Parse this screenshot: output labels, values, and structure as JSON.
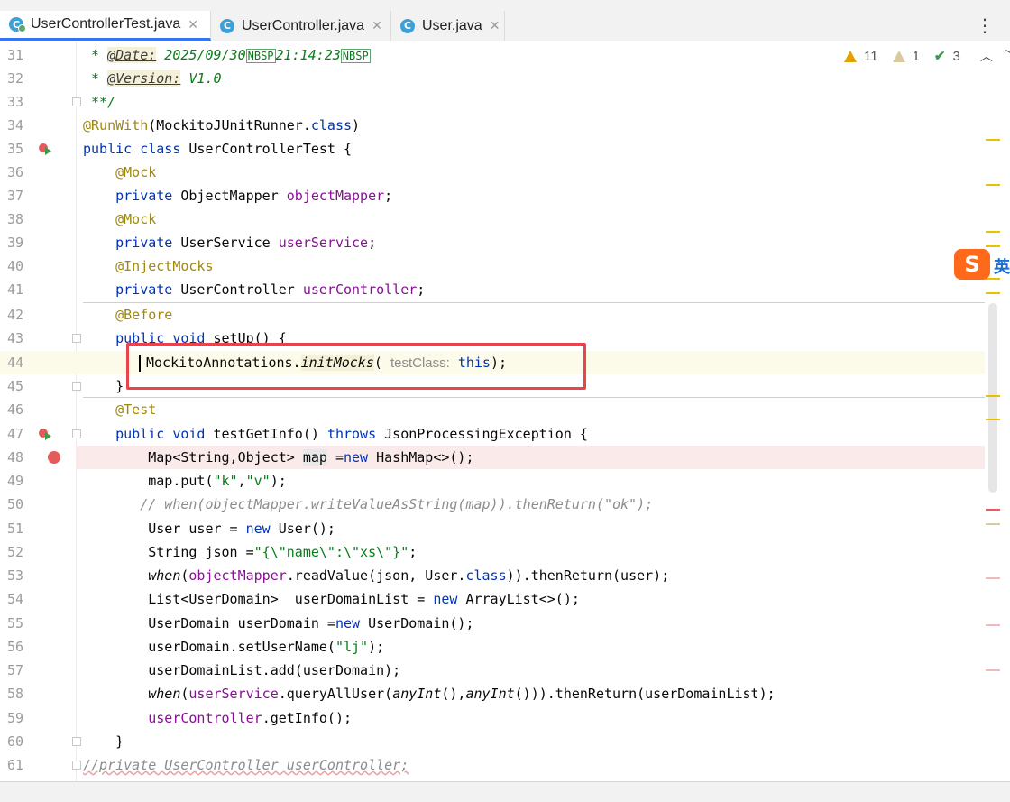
{
  "tabs": [
    {
      "label": "UserControllerTest.java",
      "active": true
    },
    {
      "label": "UserController.java",
      "active": false
    },
    {
      "label": "User.java",
      "active": false
    }
  ],
  "tab_menu_icon": "vertical-dots-icon",
  "inspections": {
    "warnings": "11",
    "weak_warnings": "1",
    "typos": "3"
  },
  "line_numbers": [
    "31",
    "32",
    "33",
    "34",
    "35",
    "36",
    "37",
    "38",
    "39",
    "40",
    "41",
    "42",
    "43",
    "44",
    "45",
    "46",
    "47",
    "48",
    "49",
    "50",
    "51",
    "52",
    "53",
    "54",
    "55",
    "56",
    "57",
    "58",
    "59",
    "60",
    "61"
  ],
  "code": {
    "l31": {
      "star": " * ",
      "tag": "@Date:",
      "val1": " 2025/09/30",
      "nb1": "NBSP",
      "val2": "21:14:23",
      "nb2": "NBSP"
    },
    "l32": {
      "star": " * ",
      "tag": "@Version:",
      "val": " V1.0"
    },
    "l33": " **/",
    "l34": {
      "ann": "@RunWith",
      "rest1": "(MockitoJUnitRunner.",
      "kw": "class",
      "rest2": ")"
    },
    "l35": {
      "kw": "public class ",
      "rest": "UserControllerTest {"
    },
    "l36": "    @Mock",
    "l37": {
      "kw": "    private ",
      "type": "ObjectMapper ",
      "fld": "objectMapper",
      "end": ";"
    },
    "l38": "    @Mock",
    "l39": {
      "kw": "    private ",
      "type": "UserService ",
      "fld": "userService",
      "end": ";"
    },
    "l40": "    @InjectMocks",
    "l41": {
      "kw": "    private ",
      "type": "UserController ",
      "fld": "userController",
      "end": ";"
    },
    "l42": "    @Before",
    "l43": {
      "kw": "    public void ",
      "rest": "setUp() {"
    },
    "l44": {
      "pre": "MockitoAnnotations.",
      "method": "initMocks",
      "open": "( ",
      "hint": "testClass:",
      "kw": " this",
      "end": ");"
    },
    "l45": "    }",
    "l46": "    @Test",
    "l47": {
      "kw1": "    public void ",
      "rest1": "testGetInfo() ",
      "kw2": "throws ",
      "rest2": "JsonProcessingException {"
    },
    "l48": {
      "pre": "        Map<String,Object> ",
      "fld": "map",
      "mid": " =",
      "kw": "new",
      "end": " HashMap<>();"
    },
    "l49": {
      "pre": "        map.put(",
      "s1": "\"k\"",
      "comma": ",",
      "s2": "\"v\"",
      "end": ");"
    },
    "l50": "       // when(objectMapper.writeValueAsString(map)).thenReturn(\"ok\");",
    "l51": {
      "pre": "        User user = ",
      "kw": "new",
      "end": " User();"
    },
    "l52": {
      "pre": "        String json =",
      "str": "\"{\\\"name\\\":\\\"xs\\\"}\"",
      "end": ";"
    },
    "l53": {
      "pre": "        ",
      "when": "when",
      "open": "(",
      "fld": "objectMapper",
      "mid": ".readValue(json, User.",
      "kw": "class",
      "end": ")).thenReturn(user);"
    },
    "l54": {
      "pre": "        List<UserDomain>  userDomainList = ",
      "kw": "new",
      "end": " ArrayList<>();"
    },
    "l55": {
      "pre": "        UserDomain userDomain =",
      "kw": "new",
      "end": " UserDomain();"
    },
    "l56": {
      "pre": "        userDomain.setUserName(",
      "str": "\"lj\"",
      "end": ");"
    },
    "l57": "        userDomainList.add(userDomain);",
    "l58": {
      "pre": "        ",
      "when": "when",
      "open": "(",
      "fld": "userService",
      "mid": ".queryAllUser(",
      "any1": "anyInt",
      "mid2": "(),",
      "any2": "anyInt",
      "end": "())).thenReturn(userDomainList);"
    },
    "l59": {
      "pre": "        ",
      "fld": "userController",
      "end": ".getInfo();"
    },
    "l60": "    }",
    "l61": "//private UserController userController;"
  },
  "ime": {
    "label": "英",
    "icon": "sogou-ime-icon"
  }
}
